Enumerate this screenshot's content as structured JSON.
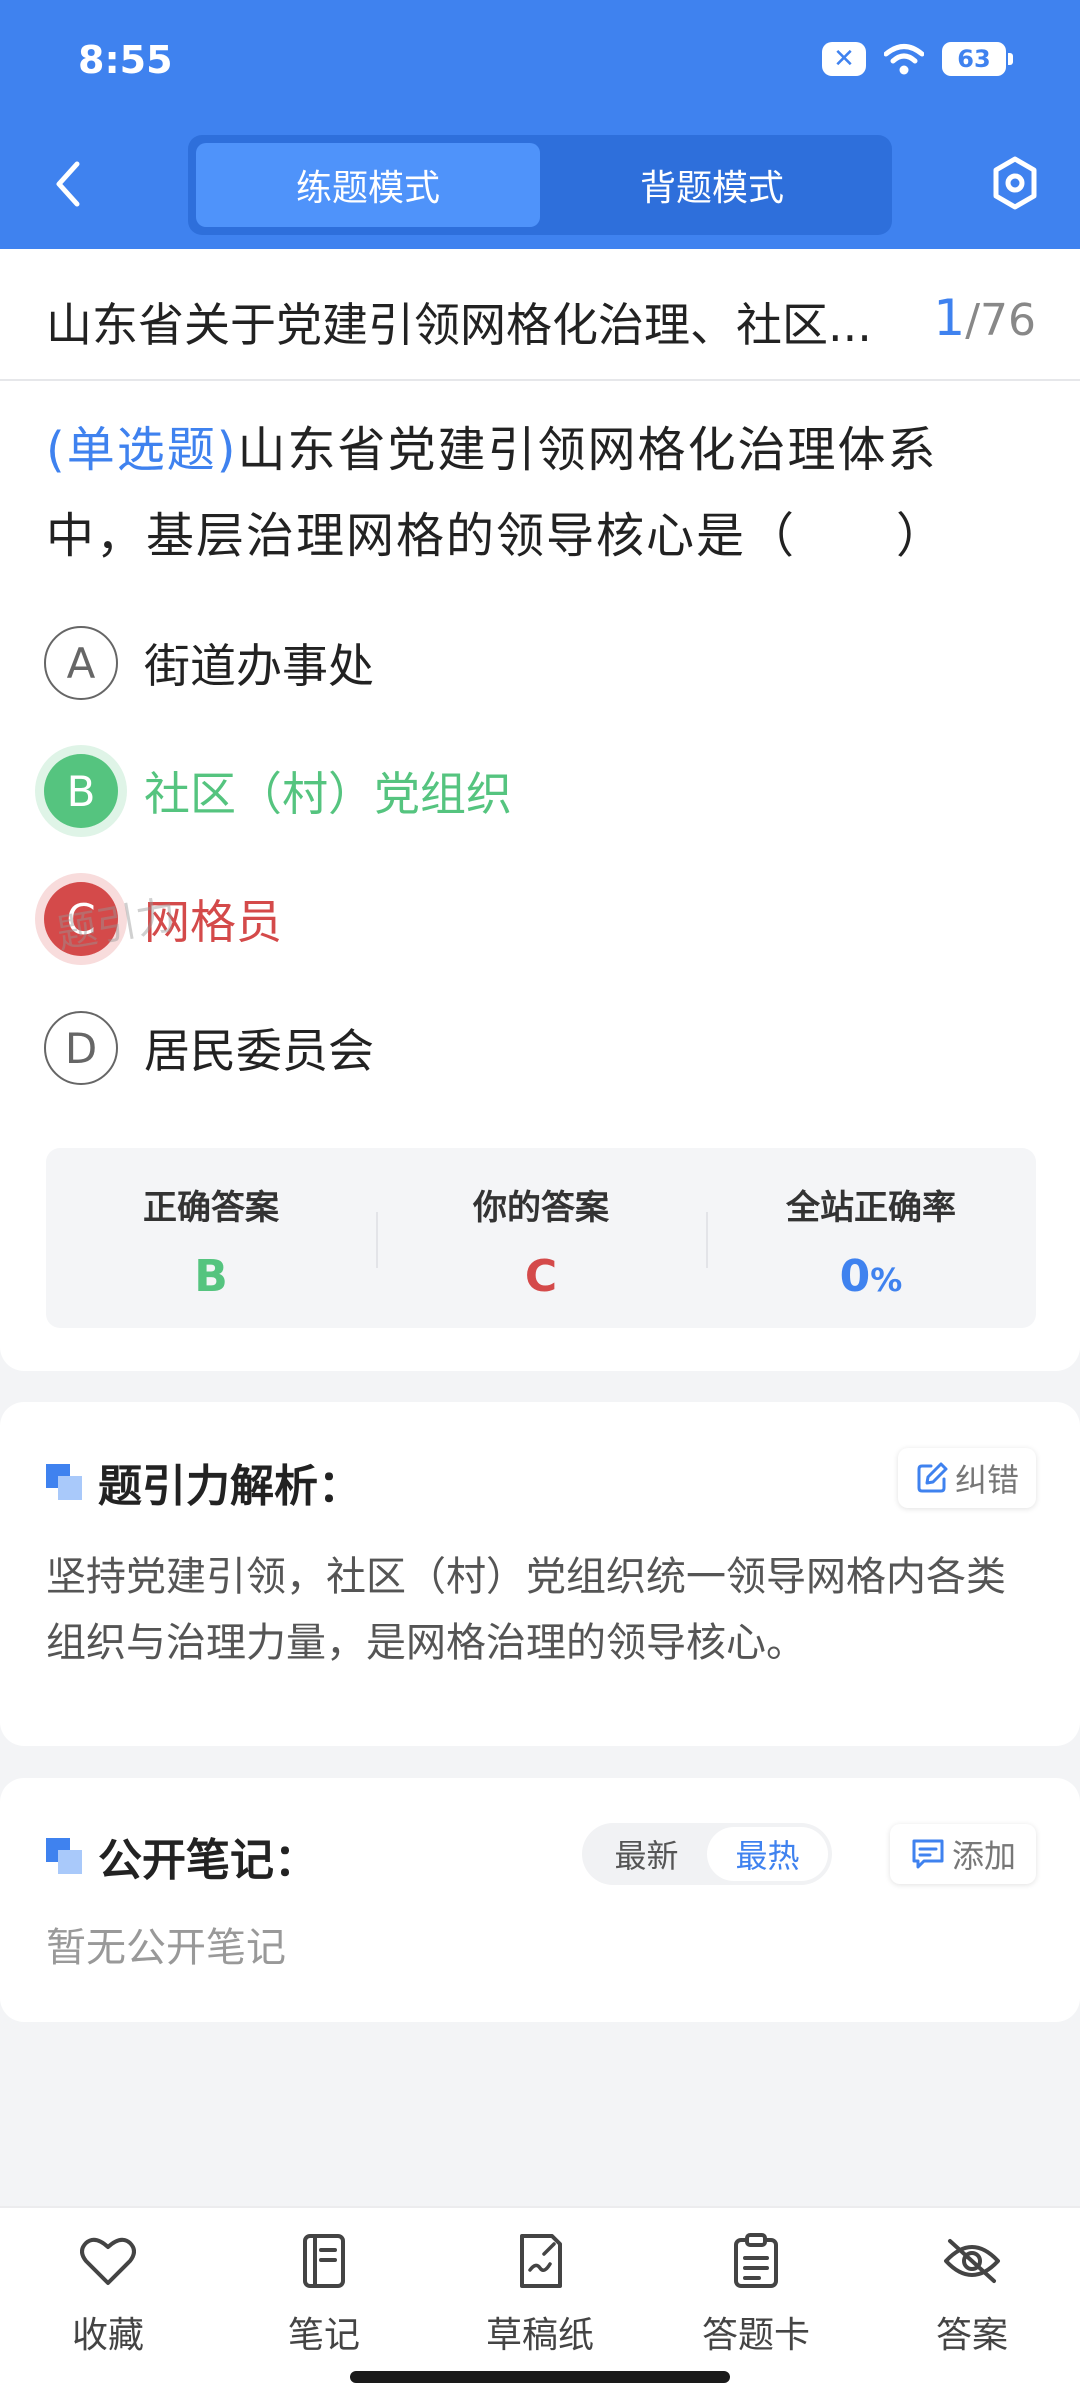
{
  "status_bar": {
    "time": "8:55",
    "battery": "63"
  },
  "header": {
    "modes": [
      "练题模式",
      "背题模式"
    ],
    "active_mode": 0
  },
  "title_bar": {
    "title": "山东省关于党建引领网格化治理、社区...",
    "current": "1",
    "total": "/76"
  },
  "question": {
    "type": "(单选题)",
    "text": "山东省党建引领网格化治理体系中，基层治理网格的领导核心是（　　）",
    "options": [
      {
        "letter": "A",
        "text": "街道办事处",
        "state": "normal"
      },
      {
        "letter": "B",
        "text": "社区（村）党组织",
        "state": "correct"
      },
      {
        "letter": "C",
        "text": "网格员",
        "state": "wrong"
      },
      {
        "letter": "D",
        "text": "居民委员会",
        "state": "normal"
      }
    ]
  },
  "answer_summary": {
    "correct_label": "正确答案",
    "correct_value": "B",
    "yours_label": "你的答案",
    "yours_value": "C",
    "rate_label": "全站正确率",
    "rate_value": "0",
    "rate_unit": "%",
    "watermark": "题引力"
  },
  "analysis": {
    "title": "题引力解析：",
    "correct_btn": "纠错",
    "text": "坚持党建引领，社区（村）党组织统一领导网格内各类组织与治理力量，是网格治理的领导核心。"
  },
  "notes": {
    "title": "公开笔记：",
    "sort_options": [
      "最新",
      "最热"
    ],
    "active_sort": 1,
    "add_btn": "添加",
    "empty_text": "暂无公开笔记"
  },
  "bottom_nav": [
    {
      "label": "收藏",
      "icon": "heart-icon"
    },
    {
      "label": "笔记",
      "icon": "notebook-icon"
    },
    {
      "label": "草稿纸",
      "icon": "draft-paper-icon"
    },
    {
      "label": "答题卡",
      "icon": "answer-sheet-icon"
    },
    {
      "label": "答案",
      "icon": "eye-off-icon"
    }
  ],
  "colors": {
    "primary": "#3F82EF",
    "correct": "#55C47F",
    "wrong": "#D44A4A"
  }
}
